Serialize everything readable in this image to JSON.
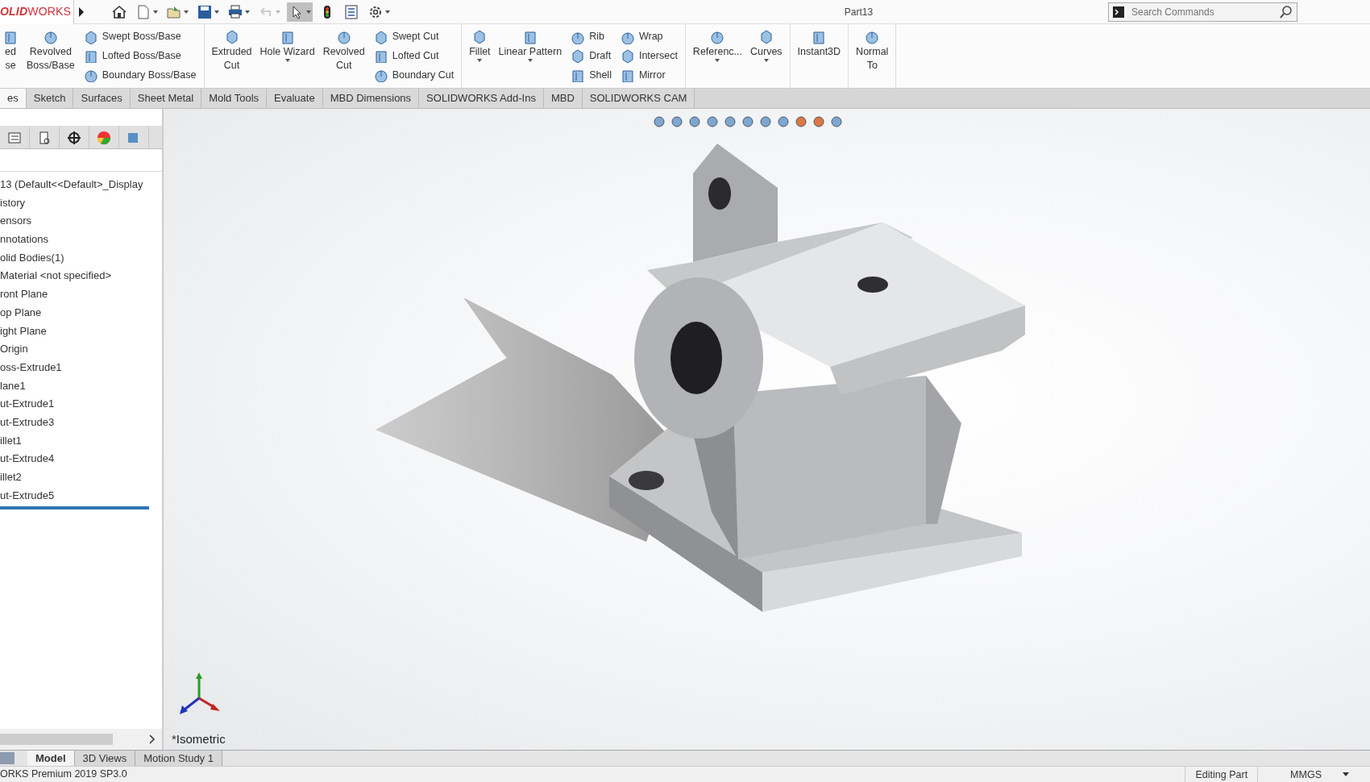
{
  "app_logo": "**OLID**WORKS",
  "window": {
    "title": "Part13"
  },
  "quick_access": [
    {
      "dropdown": false,
      "selected": false,
      "disabled": false
    },
    {
      "dropdown": true,
      "selected": false,
      "disabled": false
    },
    {
      "dropdown": true,
      "selected": false,
      "disabled": false
    },
    {
      "dropdown": true,
      "selected": false,
      "disabled": false
    },
    {
      "dropdown": true,
      "selected": false,
      "disabled": false
    },
    {
      "dropdown": true,
      "selected": false,
      "disabled": true
    },
    {
      "dropdown": true,
      "selected": true,
      "disabled": false
    },
    {
      "dropdown": false,
      "selected": false,
      "disabled": false
    },
    {
      "dropdown": false,
      "selected": false,
      "disabled": false
    },
    {
      "dropdown": true,
      "selected": false,
      "disabled": false
    }
  ],
  "search": {
    "placeholder": "Search Commands"
  },
  "ribbon": {
    "groups": [
      {
        "items": [
          {
            "kind": "large",
            "lines": [
              "ed",
              "se"
            ],
            "dropdown": false
          },
          {
            "kind": "large",
            "lines": [
              "Revolved",
              "Boss/Base"
            ],
            "dropdown": false
          },
          {
            "kind": "stack",
            "entries": [
              "Swept Boss/Base",
              "Lofted Boss/Base",
              "Boundary Boss/Base"
            ]
          }
        ]
      },
      {
        "items": [
          {
            "kind": "large",
            "lines": [
              "Extruded",
              "Cut"
            ],
            "dropdown": false
          },
          {
            "kind": "large",
            "lines": [
              "Hole Wizard"
            ],
            "dropdown": true
          },
          {
            "kind": "large",
            "lines": [
              "Revolved",
              "Cut"
            ],
            "dropdown": false
          },
          {
            "kind": "stack",
            "entries": [
              "Swept Cut",
              "Lofted Cut",
              "Boundary Cut"
            ]
          }
        ]
      },
      {
        "items": [
          {
            "kind": "large",
            "lines": [
              "Fillet"
            ],
            "dropdown": true
          },
          {
            "kind": "large",
            "lines": [
              "Linear Pattern"
            ],
            "dropdown": true
          },
          {
            "kind": "stack",
            "entries": [
              "Rib",
              "Draft",
              "Shell"
            ]
          },
          {
            "kind": "stack",
            "entries": [
              "Wrap",
              "Intersect",
              "Mirror"
            ]
          }
        ]
      },
      {
        "items": [
          {
            "kind": "large",
            "lines": [
              "Referenc..."
            ],
            "dropdown": true
          },
          {
            "kind": "large",
            "lines": [
              "Curves"
            ],
            "dropdown": true
          }
        ]
      },
      {
        "items": [
          {
            "kind": "large",
            "lines": [
              "Instant3D"
            ],
            "dropdown": false
          }
        ]
      },
      {
        "items": [
          {
            "kind": "large",
            "lines": [
              "Normal",
              "To"
            ],
            "dropdown": false
          }
        ]
      }
    ]
  },
  "tabs": [
    {
      "label": "es",
      "selected": true
    },
    {
      "label": "Sketch",
      "selected": false
    },
    {
      "label": "Surfaces",
      "selected": false
    },
    {
      "label": "Sheet Metal",
      "selected": false
    },
    {
      "label": "Mold Tools",
      "selected": false
    },
    {
      "label": "Evaluate",
      "selected": false
    },
    {
      "label": "MBD Dimensions",
      "selected": false
    },
    {
      "label": "SOLIDWORKS Add-Ins",
      "selected": false
    },
    {
      "label": "MBD",
      "selected": false
    },
    {
      "label": "SOLIDWORKS CAM",
      "selected": false
    }
  ],
  "feature_tree": {
    "items": [
      {
        "label": "13  (Default<<Default>_Display"
      },
      {
        "label": "istory"
      },
      {
        "label": "ensors"
      },
      {
        "label": "nnotations"
      },
      {
        "label": "olid Bodies(1)"
      },
      {
        "label": "Material <not specified>"
      },
      {
        "label": "ront Plane"
      },
      {
        "label": "op Plane"
      },
      {
        "label": "ight Plane"
      },
      {
        "label": "Origin"
      },
      {
        "label": "oss-Extrude1"
      },
      {
        "label": "lane1"
      },
      {
        "label": "ut-Extrude1"
      },
      {
        "label": "ut-Extrude3"
      },
      {
        "label": "illet1"
      },
      {
        "label": "ut-Extrude4"
      },
      {
        "label": "illet2"
      },
      {
        "label": "ut-Extrude5"
      }
    ]
  },
  "viewport": {
    "view_name": "*Isometric"
  },
  "bottom_tabs": [
    {
      "label": "Model",
      "selected": true
    },
    {
      "label": "3D Views",
      "selected": false
    },
    {
      "label": "Motion Study 1",
      "selected": false
    }
  ],
  "status_bar": {
    "left": "ORKS Premium 2019 SP3.0",
    "fields": [
      "Editing Part",
      "MMGS"
    ]
  }
}
